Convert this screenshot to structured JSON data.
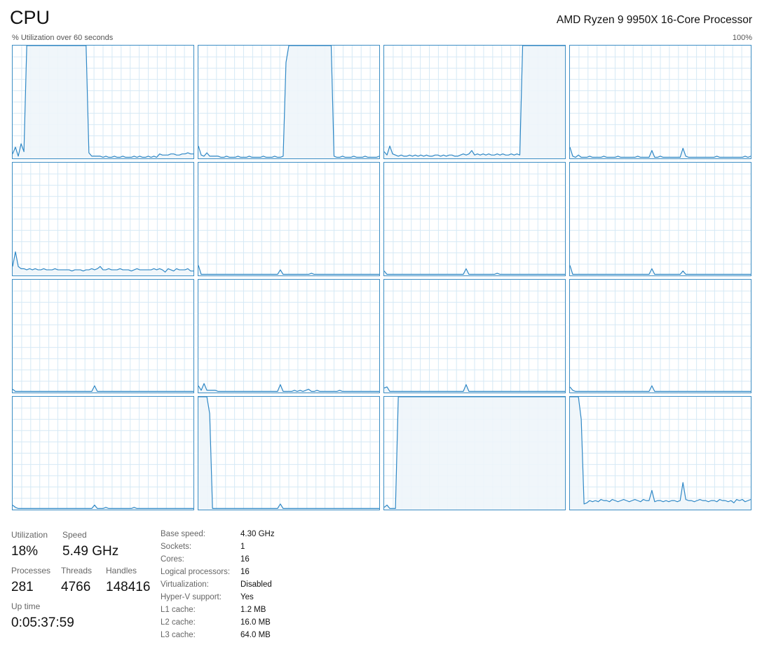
{
  "header": {
    "title": "CPU",
    "processor_name": "AMD Ryzen 9 9950X 16-Core Processor",
    "util_label": "% Utilization over 60 seconds",
    "max_label": "100%"
  },
  "colors": {
    "graph_line": "#2f88c6",
    "graph_fill": "#eef5fa",
    "graph_grid": "#d6e9f5",
    "graph_border": "#3d8ec4"
  },
  "chart_data": {
    "type": "area",
    "ylim": [
      0,
      100
    ],
    "xlim": [
      0,
      60
    ],
    "grid": true,
    "series": [
      {
        "values": [
          4,
          10,
          2,
          13,
          6,
          100,
          100,
          100,
          100,
          100,
          100,
          100,
          100,
          100,
          100,
          100,
          100,
          100,
          100,
          100,
          100,
          100,
          100,
          100,
          100,
          100,
          100,
          5,
          2,
          2,
          2,
          2,
          1,
          2,
          1,
          1,
          2,
          1,
          1,
          2,
          1,
          1,
          1,
          2,
          1,
          2,
          1,
          1,
          2,
          1,
          2,
          1,
          4,
          3,
          3,
          3,
          4,
          4,
          3,
          3,
          4,
          4,
          5,
          4,
          4
        ]
      },
      {
        "values": [
          11,
          3,
          2,
          5,
          2,
          2,
          2,
          2,
          1,
          1,
          2,
          1,
          1,
          1,
          2,
          1,
          1,
          1,
          2,
          1,
          1,
          1,
          1,
          2,
          1,
          1,
          1,
          2,
          1,
          1,
          2,
          85,
          100,
          100,
          100,
          100,
          100,
          100,
          100,
          100,
          100,
          100,
          100,
          100,
          100,
          100,
          100,
          100,
          2,
          1,
          1,
          2,
          1,
          1,
          1,
          2,
          1,
          1,
          1,
          2,
          1,
          1,
          1,
          1,
          2
        ]
      },
      {
        "values": [
          6,
          3,
          11,
          4,
          3,
          2,
          3,
          2,
          2,
          3,
          2,
          3,
          2,
          3,
          2,
          3,
          2,
          2,
          3,
          3,
          2,
          3,
          2,
          3,
          3,
          2,
          2,
          3,
          4,
          3,
          4,
          7,
          3,
          4,
          3,
          4,
          3,
          4,
          3,
          3,
          4,
          3,
          4,
          3,
          3,
          4,
          3,
          4,
          3,
          100,
          100,
          100,
          100,
          100,
          100,
          100,
          100,
          100,
          100,
          100,
          100,
          100,
          100,
          100,
          100
        ]
      },
      {
        "values": [
          10,
          2,
          1,
          3,
          1,
          1,
          1,
          2,
          1,
          1,
          1,
          1,
          2,
          1,
          1,
          1,
          1,
          2,
          1,
          1,
          1,
          1,
          1,
          1,
          2,
          1,
          1,
          1,
          1,
          7,
          1,
          1,
          2,
          1,
          1,
          1,
          1,
          1,
          1,
          1,
          9,
          2,
          1,
          1,
          1,
          1,
          1,
          1,
          1,
          1,
          1,
          1,
          2,
          1,
          1,
          1,
          1,
          1,
          1,
          1,
          1,
          1,
          2,
          1,
          2
        ]
      },
      {
        "values": [
          8,
          21,
          8,
          6,
          6,
          5,
          6,
          5,
          6,
          5,
          5,
          6,
          5,
          5,
          5,
          6,
          5,
          5,
          5,
          5,
          5,
          4,
          5,
          5,
          5,
          4,
          5,
          5,
          6,
          5,
          6,
          8,
          5,
          5,
          6,
          5,
          5,
          5,
          6,
          5,
          5,
          5,
          4,
          5,
          6,
          5,
          5,
          5,
          5,
          5,
          6,
          5,
          6,
          5,
          3,
          6,
          5,
          4,
          6,
          5,
          5,
          5,
          6,
          4,
          4
        ]
      },
      {
        "values": [
          9,
          1,
          1,
          1,
          1,
          1,
          1,
          1,
          1,
          1,
          1,
          1,
          1,
          1,
          1,
          1,
          1,
          1,
          1,
          1,
          1,
          1,
          1,
          1,
          1,
          1,
          1,
          1,
          1,
          5,
          1,
          1,
          1,
          1,
          1,
          1,
          1,
          1,
          1,
          1,
          2,
          1,
          1,
          1,
          1,
          1,
          1,
          1,
          1,
          1,
          1,
          1,
          1,
          1,
          1,
          1,
          1,
          1,
          1,
          1,
          1,
          1,
          1,
          1,
          1
        ]
      },
      {
        "values": [
          4,
          1,
          1,
          1,
          1,
          1,
          1,
          1,
          1,
          1,
          1,
          1,
          1,
          1,
          1,
          1,
          1,
          1,
          1,
          1,
          1,
          1,
          1,
          1,
          1,
          1,
          1,
          1,
          1,
          6,
          1,
          1,
          1,
          1,
          1,
          1,
          1,
          1,
          1,
          1,
          2,
          1,
          1,
          1,
          1,
          1,
          1,
          1,
          1,
          1,
          1,
          1,
          1,
          1,
          1,
          1,
          1,
          1,
          1,
          1,
          1,
          1,
          1,
          1,
          1
        ]
      },
      {
        "values": [
          9,
          1,
          1,
          1,
          1,
          1,
          1,
          1,
          1,
          1,
          1,
          1,
          1,
          1,
          1,
          1,
          1,
          1,
          1,
          1,
          1,
          1,
          1,
          1,
          1,
          1,
          1,
          1,
          1,
          6,
          1,
          1,
          1,
          1,
          1,
          1,
          1,
          1,
          1,
          1,
          4,
          1,
          1,
          1,
          1,
          1,
          1,
          1,
          1,
          1,
          1,
          1,
          1,
          1,
          1,
          1,
          1,
          1,
          1,
          1,
          1,
          1,
          1,
          1,
          1
        ]
      },
      {
        "values": [
          3,
          1,
          1,
          1,
          1,
          1,
          1,
          1,
          1,
          1,
          1,
          1,
          1,
          1,
          1,
          1,
          1,
          1,
          1,
          1,
          1,
          1,
          1,
          1,
          1,
          1,
          1,
          1,
          1,
          6,
          1,
          1,
          1,
          1,
          1,
          1,
          1,
          1,
          1,
          1,
          1,
          1,
          1,
          1,
          1,
          1,
          1,
          1,
          1,
          1,
          1,
          1,
          1,
          1,
          1,
          1,
          1,
          1,
          1,
          1,
          1,
          1,
          1,
          1,
          1
        ]
      },
      {
        "values": [
          6,
          2,
          8,
          2,
          2,
          2,
          2,
          1,
          1,
          1,
          1,
          1,
          1,
          1,
          1,
          1,
          1,
          1,
          1,
          1,
          1,
          1,
          1,
          1,
          1,
          1,
          1,
          1,
          1,
          7,
          1,
          1,
          1,
          1,
          2,
          1,
          2,
          1,
          2,
          3,
          1,
          1,
          2,
          1,
          1,
          1,
          1,
          1,
          1,
          1,
          2,
          1,
          1,
          1,
          1,
          1,
          1,
          1,
          1,
          1,
          1,
          1,
          1,
          1,
          1
        ]
      },
      {
        "values": [
          4,
          5,
          1,
          1,
          1,
          1,
          1,
          1,
          1,
          1,
          1,
          1,
          1,
          1,
          1,
          1,
          1,
          1,
          1,
          1,
          1,
          1,
          1,
          1,
          1,
          1,
          1,
          1,
          1,
          7,
          1,
          1,
          1,
          1,
          1,
          1,
          1,
          1,
          1,
          1,
          1,
          1,
          1,
          1,
          1,
          1,
          1,
          1,
          1,
          1,
          1,
          1,
          1,
          1,
          1,
          1,
          1,
          1,
          1,
          1,
          1,
          1,
          1,
          1,
          1
        ]
      },
      {
        "values": [
          5,
          2,
          1,
          1,
          1,
          1,
          1,
          1,
          1,
          1,
          1,
          1,
          1,
          1,
          1,
          1,
          1,
          1,
          1,
          1,
          1,
          1,
          1,
          1,
          1,
          1,
          1,
          1,
          1,
          6,
          1,
          1,
          1,
          1,
          1,
          1,
          1,
          1,
          1,
          1,
          1,
          1,
          1,
          1,
          1,
          1,
          1,
          1,
          1,
          1,
          1,
          1,
          1,
          1,
          1,
          1,
          1,
          1,
          1,
          1,
          1,
          1,
          1,
          1,
          1
        ]
      },
      {
        "values": [
          4,
          2,
          1,
          1,
          1,
          1,
          1,
          1,
          1,
          1,
          1,
          1,
          1,
          1,
          1,
          1,
          1,
          1,
          1,
          1,
          1,
          1,
          1,
          1,
          1,
          1,
          1,
          1,
          1,
          4,
          1,
          1,
          1,
          2,
          1,
          1,
          1,
          1,
          1,
          1,
          1,
          1,
          1,
          2,
          1,
          1,
          1,
          1,
          1,
          1,
          1,
          1,
          1,
          1,
          1,
          1,
          1,
          1,
          1,
          1,
          1,
          1,
          1,
          1,
          1
        ]
      },
      {
        "values": [
          100,
          100,
          100,
          100,
          85,
          1,
          1,
          1,
          1,
          1,
          1,
          1,
          1,
          1,
          1,
          1,
          1,
          1,
          1,
          1,
          1,
          1,
          1,
          1,
          1,
          1,
          1,
          1,
          1,
          5,
          1,
          1,
          1,
          1,
          1,
          1,
          1,
          1,
          1,
          1,
          1,
          1,
          1,
          1,
          1,
          1,
          1,
          1,
          1,
          1,
          1,
          1,
          1,
          1,
          1,
          1,
          1,
          1,
          1,
          1,
          1,
          1,
          1,
          1,
          1
        ]
      },
      {
        "values": [
          2,
          4,
          1,
          1,
          1,
          100,
          100,
          100,
          100,
          100,
          100,
          100,
          100,
          100,
          100,
          100,
          100,
          100,
          100,
          100,
          100,
          100,
          100,
          100,
          100,
          100,
          100,
          100,
          100,
          100,
          100,
          100,
          100,
          100,
          100,
          100,
          100,
          100,
          100,
          100,
          100,
          100,
          100,
          100,
          100,
          100,
          100,
          100,
          100,
          100,
          100,
          100,
          100,
          100,
          100,
          100,
          100,
          100,
          100,
          100,
          100,
          100,
          100,
          100,
          100
        ]
      },
      {
        "values": [
          100,
          100,
          100,
          100,
          80,
          5,
          6,
          8,
          7,
          8,
          7,
          9,
          8,
          8,
          7,
          9,
          8,
          7,
          8,
          9,
          8,
          7,
          8,
          9,
          8,
          7,
          9,
          8,
          8,
          17,
          7,
          8,
          8,
          7,
          8,
          7,
          8,
          8,
          7,
          8,
          24,
          9,
          8,
          8,
          7,
          8,
          9,
          8,
          8,
          7,
          8,
          8,
          7,
          9,
          8,
          8,
          7,
          8,
          6,
          9,
          8,
          9,
          7,
          8,
          9
        ]
      }
    ]
  },
  "stats": {
    "utilization": {
      "label": "Utilization",
      "value": "18%"
    },
    "speed": {
      "label": "Speed",
      "value": "5.49 GHz"
    },
    "processes": {
      "label": "Processes",
      "value": "281"
    },
    "threads": {
      "label": "Threads",
      "value": "4766"
    },
    "handles": {
      "label": "Handles",
      "value": "148416"
    },
    "uptime": {
      "label": "Up time",
      "value": "0:05:37:59"
    }
  },
  "info": [
    {
      "key": "Base speed:",
      "value": "4.30 GHz"
    },
    {
      "key": "Sockets:",
      "value": "1"
    },
    {
      "key": "Cores:",
      "value": "16"
    },
    {
      "key": "Logical processors:",
      "value": "16"
    },
    {
      "key": "Virtualization:",
      "value": "Disabled"
    },
    {
      "key": "Hyper-V support:",
      "value": "Yes"
    },
    {
      "key": "L1 cache:",
      "value": "1.2 MB"
    },
    {
      "key": "L2 cache:",
      "value": "16.0 MB"
    },
    {
      "key": "L3 cache:",
      "value": "64.0 MB"
    }
  ]
}
